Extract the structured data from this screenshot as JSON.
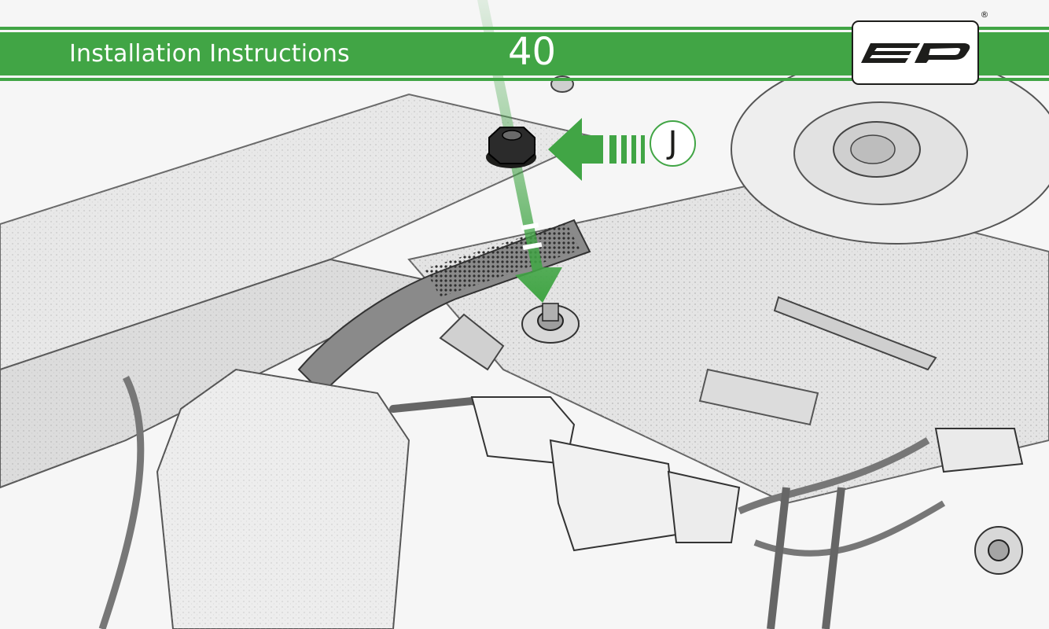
{
  "header": {
    "title": "Installation Instructions",
    "step_number": "40",
    "registered_mark": "®",
    "accent_color": "#41a545"
  },
  "illustration": {
    "description_icon": "vehicle-underbody-sketch",
    "callout": {
      "label": "J"
    },
    "part_icon": "flange-nut-icon"
  }
}
